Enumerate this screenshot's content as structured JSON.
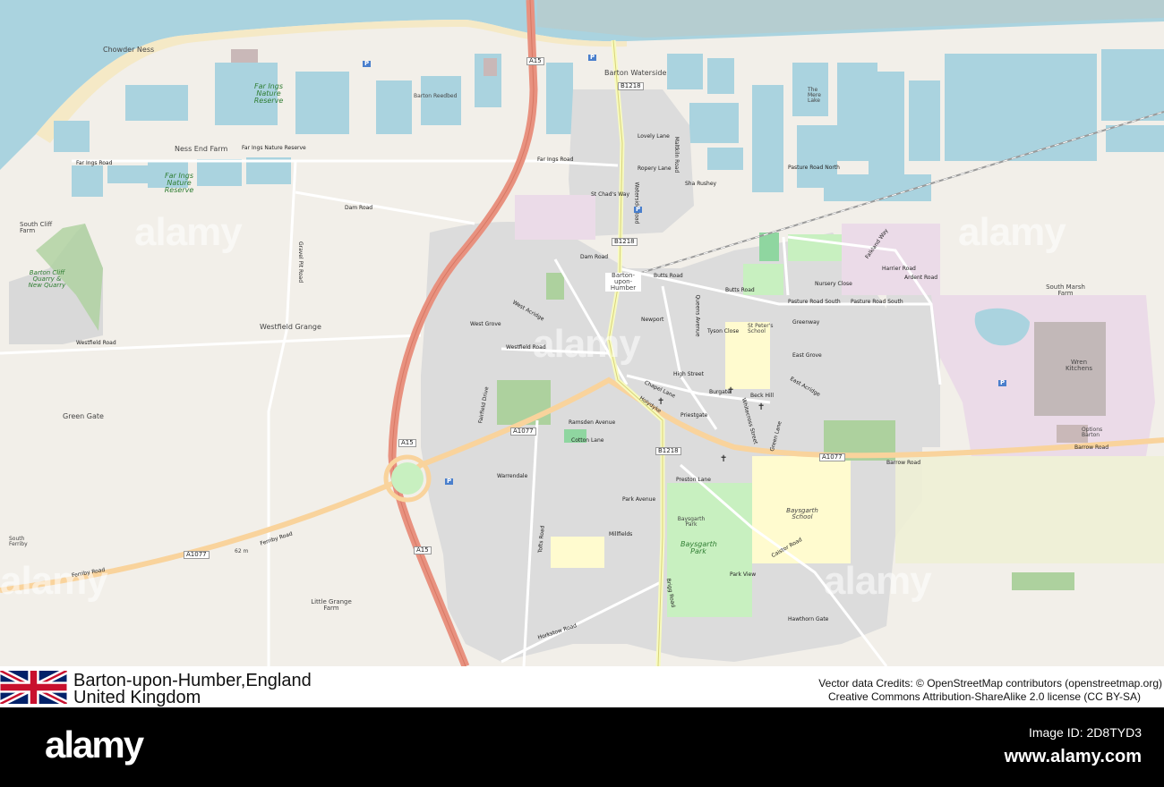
{
  "map": {
    "place_labels": [
      "Chowder Ness",
      "Barton Waterside",
      "Ness End Farm",
      "South Cliff Farm",
      "Westfield Grange",
      "Green Gate",
      "Little Grange Farm",
      "South Marsh Farm",
      "Barton-upon-Humber",
      "Barton Reedbed",
      "The Mere Lake",
      "St Peter's School",
      "Wren Kitchens",
      "Baysgarth School",
      "Baysgarth Park",
      "Options Barton",
      "Barton Cliff Quarry & New Quarry",
      "South Ferriby",
      "62 m"
    ],
    "nature_labels": [
      "Far Ings Nature Reserve",
      "Far Ings Nature Reserve",
      "Baysgarth Park"
    ],
    "road_labels": [
      "Far Ings Road",
      "Far Ings Road",
      "Dam Road",
      "Dam Road",
      "Waterside Road",
      "Marsh Lane",
      "Westfield Road",
      "Westfield Road",
      "Ferriby Road",
      "Ferriby Road",
      "Barrow Road",
      "Barrow Road",
      "Butts Road",
      "Butts Road",
      "Pasture Road North",
      "Pasture Road South",
      "Pasture Road South",
      "Falkland Way",
      "Harrier Road",
      "Ardent Road",
      "High Street",
      "Holydyke",
      "Brigg Road",
      "Preston Lane",
      "Park Avenue",
      "Park View",
      "Horkstow Road",
      "Tofts Road",
      "Caistor Road",
      "Gravel Pit Road",
      "Far Ings Nature Reserve",
      "Newport",
      "Queens Avenue",
      "Fleetgate",
      "Whitecross Street",
      "Green Lane",
      "East Acridge",
      "West Acridge",
      "West Grove",
      "East Grove",
      "Greenway",
      "Nursery Close",
      "Tyson Close",
      "Lovely Lane",
      "Ropery Lane",
      "Maltkiln Road",
      "St Chad's Way",
      "Sha Rushey",
      "Hawthorn Gate",
      "Millfields",
      "Ramsden Avenue",
      "Warrendale",
      "Fairfield Drive",
      "Cotton Lane",
      "Priestgate",
      "Burgate",
      "Chapel Lane",
      "Beck Hill",
      "Marsh Lane",
      "Butts Road",
      "Newport"
    ],
    "shields": [
      "A15",
      "A15",
      "A15",
      "A1077",
      "A1077",
      "A1077",
      "B1218",
      "B1218",
      "B1218"
    ],
    "parking_symbol": "P",
    "watermark": "alamy"
  },
  "location": {
    "line1": "Barton-upon-Humber,England",
    "line2": "United Kingdom",
    "flag": "union-jack-flag"
  },
  "credits": {
    "line1": "Vector data Credits: © OpenStreetMap contributors (openstreetmap.org)",
    "line2": "Creative Commons Attribution-ShareAlike 2.0 license (CC BY-SA)"
  },
  "footer": {
    "brand": "alamy",
    "image_id": "Image ID: 2D8TYD3",
    "url": "www.alamy.com"
  },
  "colors": {
    "land": "#f2efe9",
    "water": "#aad3df",
    "motorway": "#e8917f",
    "primary_road": "#f9d39c",
    "secondary_road": "#f7fabf",
    "residential": "#dcdcdc",
    "park": "#c8f0c0",
    "school": "#fffbcf",
    "industrial": "#ebdbe8",
    "wood": "#add19e"
  }
}
